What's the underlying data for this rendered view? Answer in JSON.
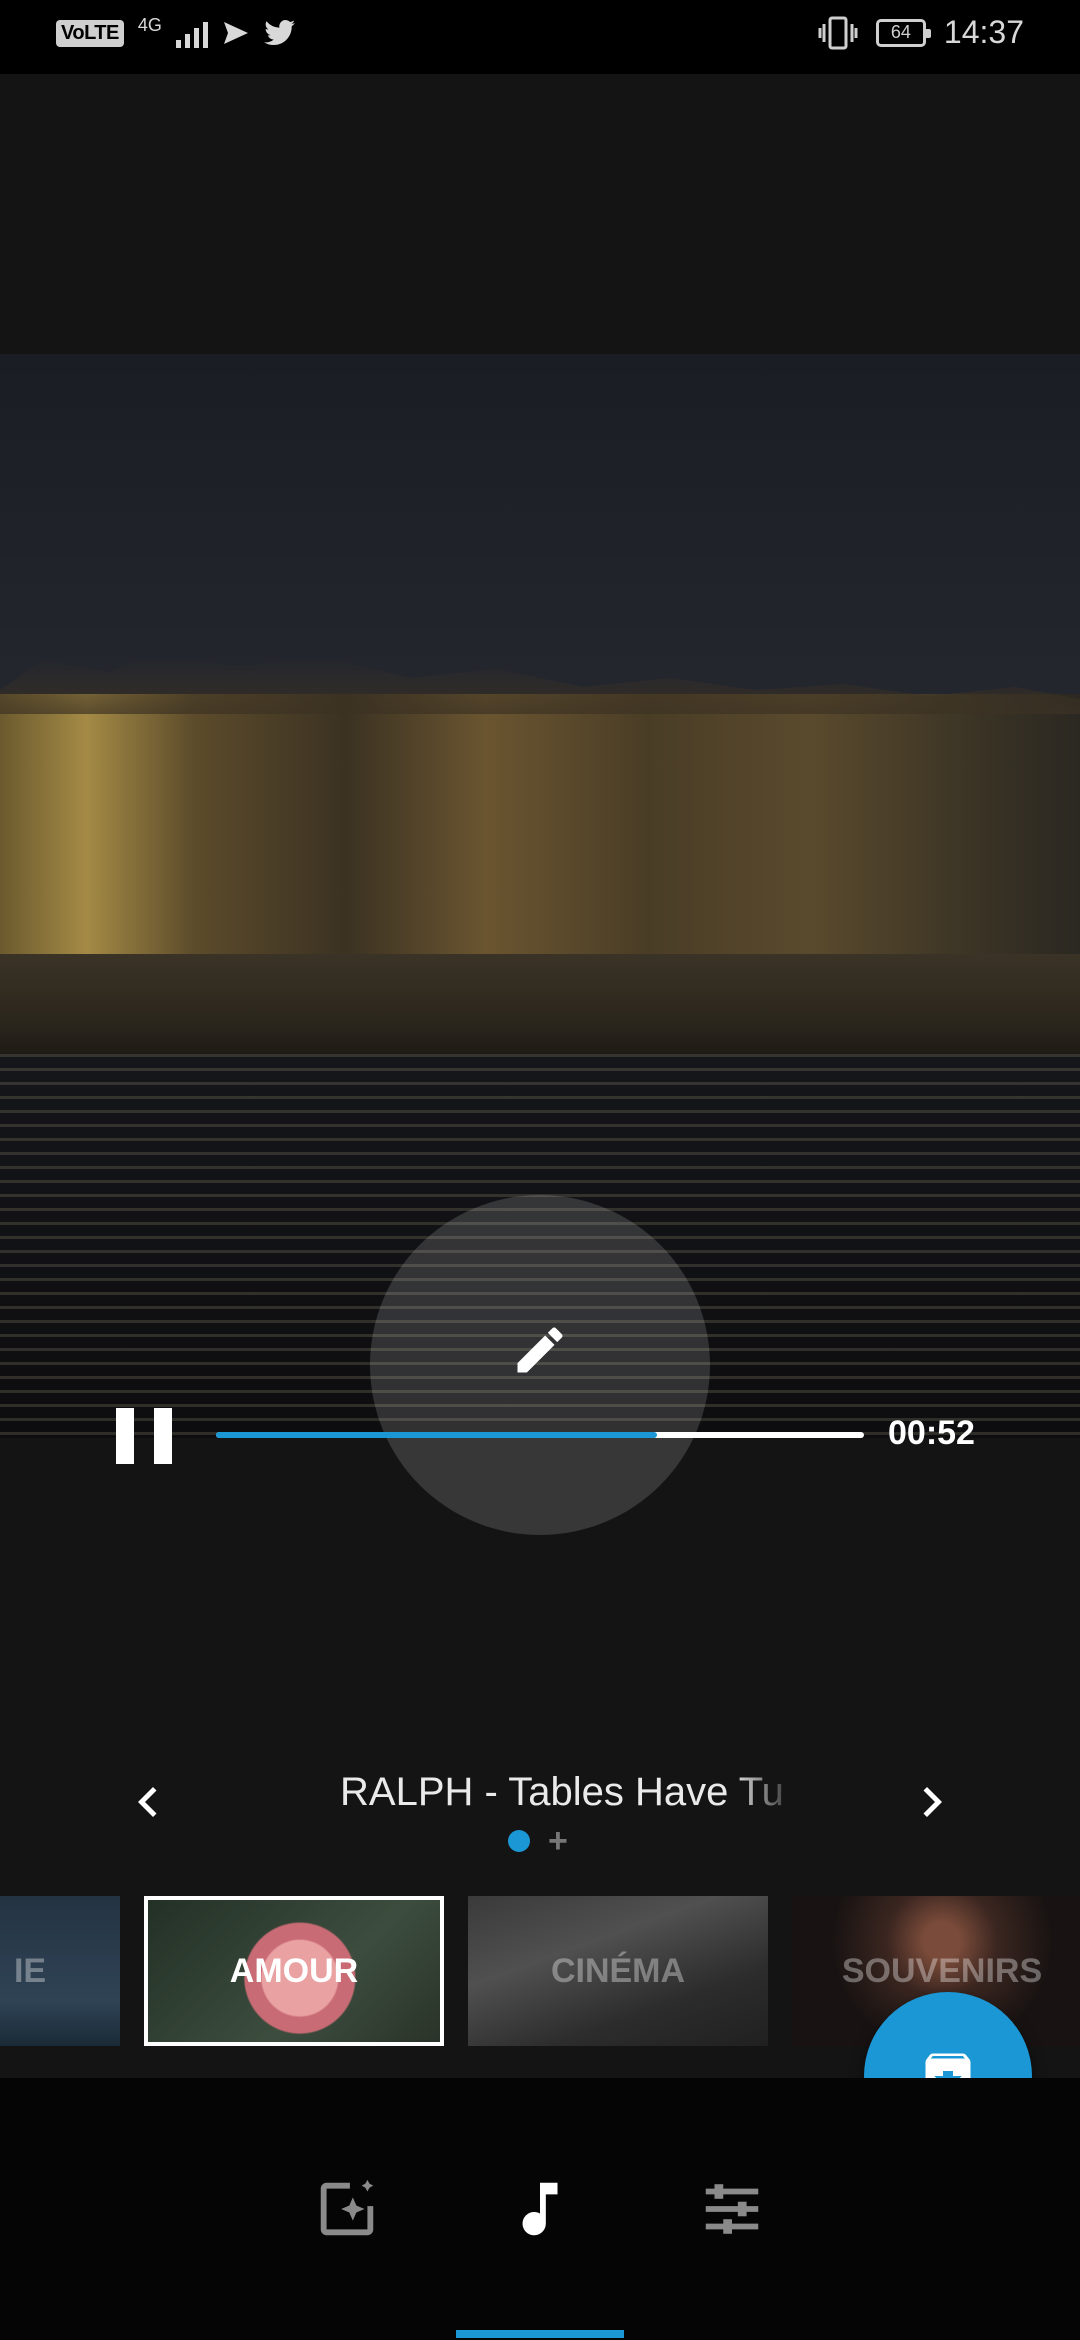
{
  "status_bar": {
    "volte": "VoLTE",
    "network": "4G",
    "time": "14:37",
    "battery": "64"
  },
  "player": {
    "elapsed": "00:52",
    "progress_fraction": 0.68
  },
  "music": {
    "track_title": "RALPH - Tables Have Tu"
  },
  "themes": [
    {
      "label": "IE",
      "selected": false
    },
    {
      "label": "AMOUR",
      "selected": true
    },
    {
      "label": "CINÉMA",
      "selected": false
    },
    {
      "label": "SOUVENIRS",
      "selected": false
    }
  ],
  "colors": {
    "accent": "#1a97d4"
  },
  "icons": {
    "edit": "pencil-icon",
    "pause": "pause-icon",
    "prev": "chevron-left-icon",
    "next": "chevron-right-icon",
    "export": "download-box-icon",
    "nav_themes": "sparkle-photo-icon",
    "nav_music": "music-note-icon",
    "nav_settings": "sliders-icon"
  }
}
